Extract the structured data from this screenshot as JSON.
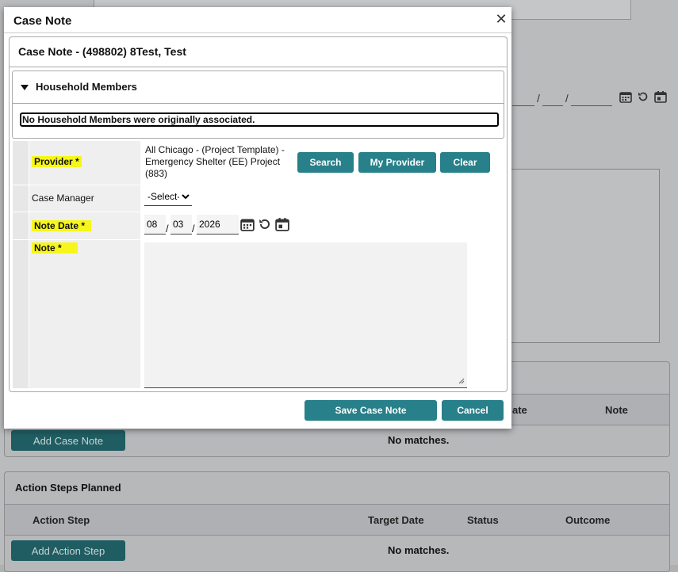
{
  "colors": {
    "accent": "#27808a",
    "highlight": "#f6f61c",
    "dark_button": "#1f5d62"
  },
  "background": {
    "case_notes_panel": {
      "columns": [
        "ate",
        "Note"
      ],
      "add_button": "Add Case Note",
      "empty_text": "No matches."
    },
    "action_steps_panel": {
      "title": "Action Steps Planned",
      "columns": [
        "Action Step",
        "Target Date",
        "Status",
        "Outcome"
      ],
      "add_button": "Add Action Step",
      "empty_text": "No matches."
    }
  },
  "modal": {
    "title": "Case Note",
    "header": "Case Note - (498802) 8Test, Test",
    "household": {
      "title": "Household Members",
      "message": "No Household Members were originally associated."
    },
    "form": {
      "provider_label": "Provider",
      "required_mark": "*",
      "provider_value": "All Chicago - (Project Template) - Emergency Shelter (EE) Project (883)",
      "search_button": "Search",
      "my_provider_button": "My Provider",
      "clear_button": "Clear",
      "case_manager_label": "Case Manager",
      "case_manager_value": "-Select-",
      "note_date_label": "Note Date",
      "note_date": {
        "month": "08",
        "day": "03",
        "year": "2026",
        "separator": "/"
      },
      "note_label": "Note",
      "note_value": ""
    },
    "save_button": "Save Case Note",
    "cancel_button": "Cancel"
  }
}
